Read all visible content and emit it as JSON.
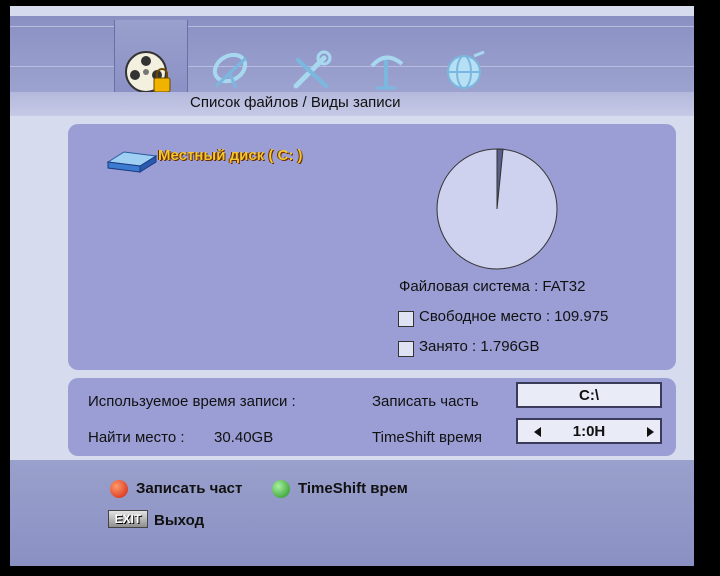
{
  "header": {
    "title": "Список файлов / Виды записи",
    "tabs": [
      {
        "icon": "film-reel-lock-icon",
        "active": true
      },
      {
        "icon": "satellite-dish-icon",
        "active": false
      },
      {
        "icon": "tools-icon",
        "active": false
      },
      {
        "icon": "antenna-icon",
        "active": false
      },
      {
        "icon": "globe-icon",
        "active": false
      }
    ]
  },
  "disk": {
    "icon": "hard-disk-icon",
    "label": "Местный диск ( C: )",
    "file_system": "Файловая система : FAT32",
    "free_space": "Свободное место : 109.975",
    "used_space": "Занято : 1.796GB",
    "used_fraction": 0.016
  },
  "record": {
    "used_time_label": "Используемое время записи :",
    "find_place_label": "Найти место :",
    "find_place_value": "30.40GB",
    "record_part_label": "Записать часть",
    "record_part_value": "C:\\",
    "timeshift_label": "TimeShift время",
    "timeshift_value": "1:0H"
  },
  "footer": {
    "red_hint": "Записать част",
    "green_hint": "TimeShift врем",
    "exit_button": "EXIT",
    "exit_hint": "Выход"
  },
  "colors": {
    "red": "#e03020",
    "green": "#30c030",
    "panel": "#9a9ed4",
    "disk_label": "#f2c832"
  }
}
